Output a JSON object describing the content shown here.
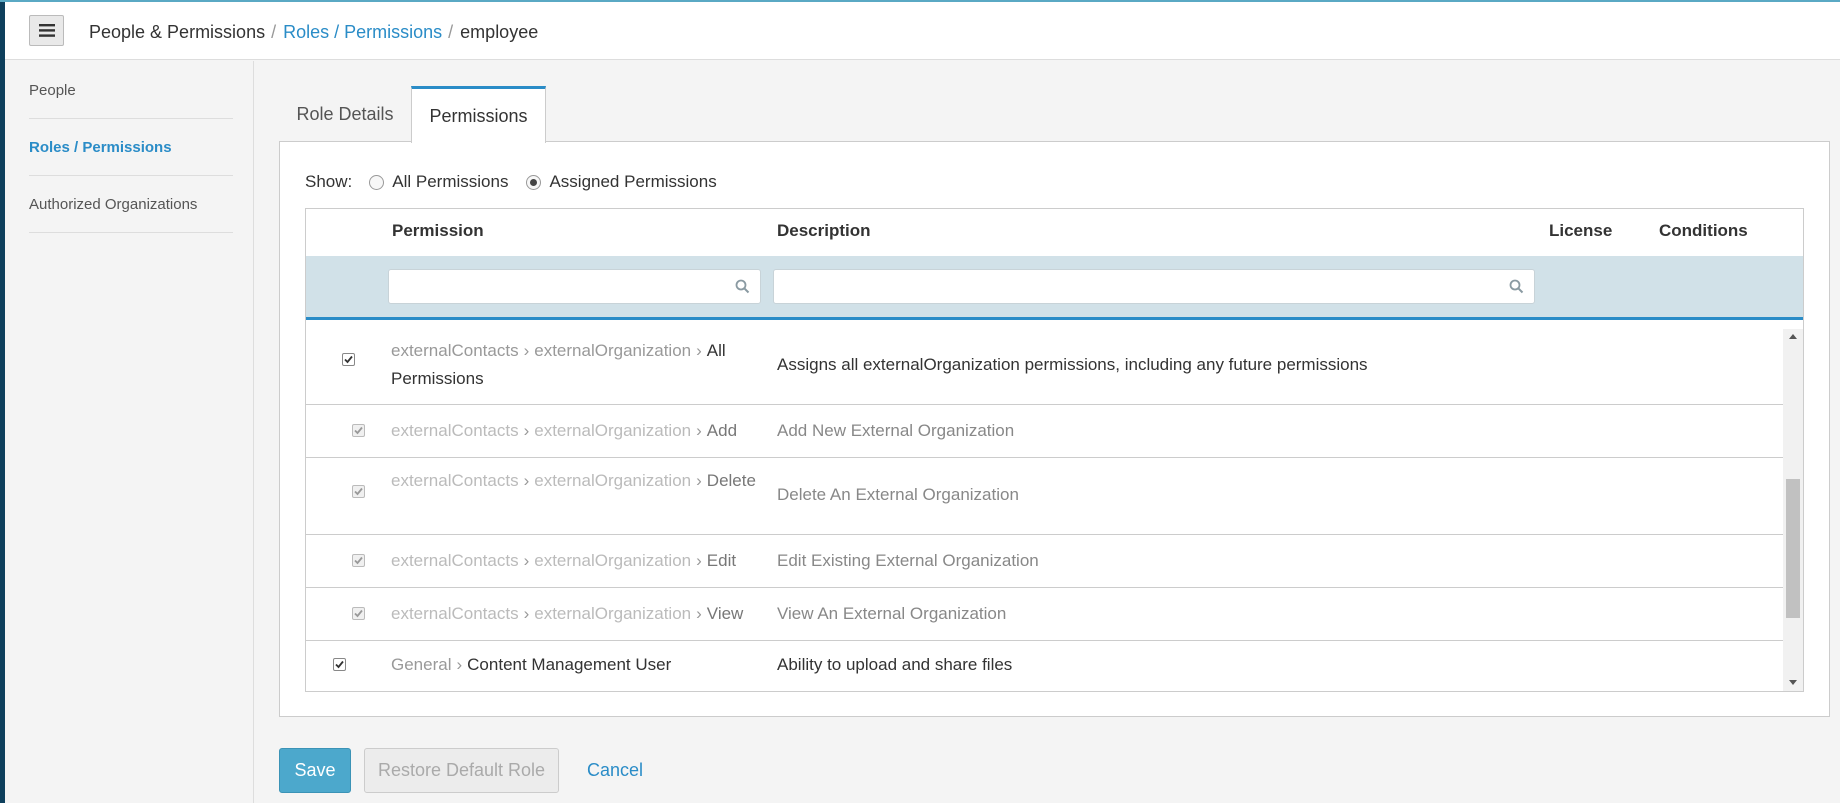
{
  "header": {
    "breadcrumb": {
      "root": "People & Permissions",
      "section": "Roles / Permissions",
      "current": "employee"
    }
  },
  "sidebar": {
    "items": [
      {
        "label": "People",
        "active": false
      },
      {
        "label": "Roles / Permissions",
        "active": true
      },
      {
        "label": "Authorized Organizations",
        "active": false
      }
    ]
  },
  "tabs": [
    {
      "label": "Role Details",
      "active": false
    },
    {
      "label": "Permissions",
      "active": true
    }
  ],
  "show": {
    "label": "Show:",
    "options": [
      {
        "label": "All Permissions",
        "checked": false
      },
      {
        "label": "Assigned Permissions",
        "checked": true
      }
    ]
  },
  "table": {
    "columns": {
      "permission": "Permission",
      "description": "Description",
      "license": "License",
      "conditions": "Conditions"
    },
    "filters": {
      "permission_value": "",
      "description_value": ""
    },
    "rows": [
      {
        "path1": "externalContacts",
        "path2": "externalOrganization",
        "name": "All Permissions",
        "description": "Assigns all externalOrganization permissions, including any future permissions",
        "checked": true,
        "inherited": false
      },
      {
        "path1": "externalContacts",
        "path2": "externalOrganization",
        "name": "Add",
        "description": "Add New External Organization",
        "checked": true,
        "inherited": true
      },
      {
        "path1": "externalContacts",
        "path2": "externalOrganization",
        "name": "Delete",
        "description": "Delete An External Organization",
        "checked": true,
        "inherited": true
      },
      {
        "path1": "externalContacts",
        "path2": "externalOrganization",
        "name": "Edit",
        "description": "Edit Existing External Organization",
        "checked": true,
        "inherited": true
      },
      {
        "path1": "externalContacts",
        "path2": "externalOrganization",
        "name": "View",
        "description": "View An External Organization",
        "checked": true,
        "inherited": true
      },
      {
        "path1": "General",
        "name": "Content Management User",
        "description": "Ability to upload and share files",
        "checked": true,
        "inherited": false
      }
    ]
  },
  "actions": {
    "save": "Save",
    "restore": "Restore Default Role",
    "cancel": "Cancel"
  },
  "colors": {
    "accent": "#2a8cc7",
    "save_button": "#4ca8cc",
    "filter_bar": "#d1e1e8"
  }
}
